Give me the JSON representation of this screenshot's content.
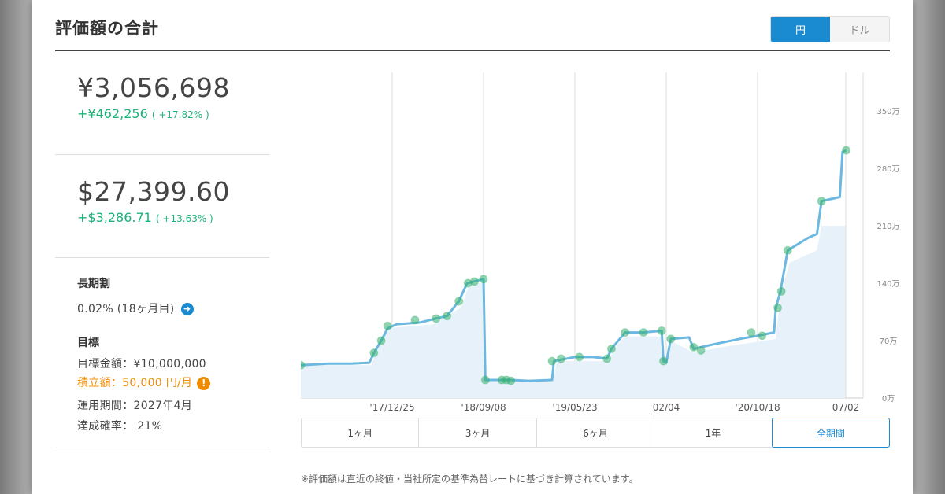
{
  "title": "評価額の合計",
  "currency_toggle": {
    "yen_label": "円",
    "dollar_label": "ドル",
    "active": "yen"
  },
  "yen_summary": {
    "amount": "¥3,056,698",
    "change": "+¥462,256",
    "change_pct": "( +17.82% )"
  },
  "usd_summary": {
    "amount": "$27,399.60",
    "change": "+$3,286.71",
    "change_pct": "( +13.63% )"
  },
  "long_term": {
    "label": "長期割",
    "value": "0.02% (18ヶ月目)"
  },
  "goal": {
    "label": "目標",
    "target_amount": "目標金額：¥10,000,000",
    "monthly_contribution": "積立額：50,000 円/月",
    "period": "運用期間：2027年4月",
    "probability": "達成確率：  21%"
  },
  "range_tabs": [
    "1ヶ月",
    "3ヶ月",
    "6ヶ月",
    "1年",
    "全期間"
  ],
  "active_range": "全期間",
  "footnote": "※評価額は直近の終値・当社所定の基準為替レートに基づき計算されています。",
  "colors": {
    "accent": "#1a8ad1",
    "positive": "#1ab37a",
    "warning": "#f08c00",
    "line": "#6cb8e0",
    "area": "#e6f1f9",
    "marker": "#33b06c"
  },
  "chart_data": {
    "type": "line",
    "x_ticks": [
      "'17/12/25",
      "'18/09/08",
      "'19/05/23",
      "02/04",
      "'20/10/18",
      "07/02"
    ],
    "y_ticks": [
      "0万",
      "70万",
      "140万",
      "210万",
      "280万",
      "350万"
    ],
    "ylim": [
      0,
      350
    ],
    "y_unit": "万円",
    "grid": "vertical",
    "series": [
      {
        "values": [
          {
            "x": 0.0,
            "y": 40
          },
          {
            "x": 0.3,
            "y": 42
          },
          {
            "x": 0.55,
            "y": 42
          },
          {
            "x": 0.75,
            "y": 43
          },
          {
            "x": 0.8,
            "y": 55
          },
          {
            "x": 0.88,
            "y": 70
          },
          {
            "x": 0.95,
            "y": 85
          },
          {
            "x": 1.05,
            "y": 90
          },
          {
            "x": 1.3,
            "y": 92
          },
          {
            "x": 1.48,
            "y": 97
          },
          {
            "x": 1.6,
            "y": 100
          },
          {
            "x": 1.73,
            "y": 118
          },
          {
            "x": 1.82,
            "y": 140
          },
          {
            "x": 2.0,
            "y": 145
          },
          {
            "x": 2.02,
            "y": 22
          },
          {
            "x": 2.3,
            "y": 22
          },
          {
            "x": 2.5,
            "y": 21
          },
          {
            "x": 2.75,
            "y": 22
          },
          {
            "x": 2.77,
            "y": 45
          },
          {
            "x": 3.0,
            "y": 50
          },
          {
            "x": 3.2,
            "y": 50
          },
          {
            "x": 3.35,
            "y": 48
          },
          {
            "x": 3.4,
            "y": 60
          },
          {
            "x": 3.55,
            "y": 80
          },
          {
            "x": 3.75,
            "y": 80
          },
          {
            "x": 3.95,
            "y": 82
          },
          {
            "x": 3.97,
            "y": 45
          },
          {
            "x": 4.0,
            "y": 43
          },
          {
            "x": 4.05,
            "y": 72
          },
          {
            "x": 4.25,
            "y": 74
          },
          {
            "x": 4.3,
            "y": 60
          },
          {
            "x": 4.5,
            "y": 65
          },
          {
            "x": 4.8,
            "y": 72
          },
          {
            "x": 5.0,
            "y": 76
          },
          {
            "x": 5.18,
            "y": 80
          },
          {
            "x": 5.2,
            "y": 110
          },
          {
            "x": 5.25,
            "y": 130
          },
          {
            "x": 5.33,
            "y": 180
          },
          {
            "x": 5.55,
            "y": 195
          },
          {
            "x": 5.65,
            "y": 200
          },
          {
            "x": 5.7,
            "y": 240
          },
          {
            "x": 5.9,
            "y": 245
          },
          {
            "x": 5.93,
            "y": 300
          },
          {
            "x": 5.97,
            "y": 302
          }
        ]
      },
      {
        "values": [
          {
            "x": 0.0,
            "y": 40
          },
          {
            "x": 0.78,
            "y": 40
          },
          {
            "x": 0.82,
            "y": 60
          },
          {
            "x": 0.95,
            "y": 85
          },
          {
            "x": 1.45,
            "y": 90
          },
          {
            "x": 1.75,
            "y": 110
          },
          {
            "x": 1.85,
            "y": 140
          },
          {
            "x": 2.0,
            "y": 140
          },
          {
            "x": 2.02,
            "y": 22
          },
          {
            "x": 2.77,
            "y": 22
          },
          {
            "x": 2.8,
            "y": 45
          },
          {
            "x": 3.38,
            "y": 45
          },
          {
            "x": 3.42,
            "y": 60
          },
          {
            "x": 3.55,
            "y": 75
          },
          {
            "x": 3.95,
            "y": 75
          },
          {
            "x": 3.97,
            "y": 45
          },
          {
            "x": 4.05,
            "y": 70
          },
          {
            "x": 4.3,
            "y": 55
          },
          {
            "x": 4.6,
            "y": 62
          },
          {
            "x": 5.2,
            "y": 72
          },
          {
            "x": 5.25,
            "y": 125
          },
          {
            "x": 5.35,
            "y": 165
          },
          {
            "x": 5.65,
            "y": 180
          },
          {
            "x": 5.7,
            "y": 210
          },
          {
            "x": 5.96,
            "y": 210
          }
        ]
      }
    ],
    "markers": [
      {
        "x": 0.0,
        "y": 40
      },
      {
        "x": 0.8,
        "y": 55
      },
      {
        "x": 0.88,
        "y": 70
      },
      {
        "x": 0.95,
        "y": 88
      },
      {
        "x": 1.25,
        "y": 95
      },
      {
        "x": 1.48,
        "y": 97
      },
      {
        "x": 1.6,
        "y": 100
      },
      {
        "x": 1.73,
        "y": 118
      },
      {
        "x": 1.83,
        "y": 140
      },
      {
        "x": 1.9,
        "y": 142
      },
      {
        "x": 2.0,
        "y": 145
      },
      {
        "x": 2.02,
        "y": 22
      },
      {
        "x": 2.2,
        "y": 22
      },
      {
        "x": 2.25,
        "y": 22
      },
      {
        "x": 2.3,
        "y": 21
      },
      {
        "x": 2.75,
        "y": 45
      },
      {
        "x": 2.85,
        "y": 48
      },
      {
        "x": 3.05,
        "y": 50
      },
      {
        "x": 3.35,
        "y": 48
      },
      {
        "x": 3.4,
        "y": 60
      },
      {
        "x": 3.55,
        "y": 80
      },
      {
        "x": 3.75,
        "y": 80
      },
      {
        "x": 3.95,
        "y": 82
      },
      {
        "x": 3.97,
        "y": 45
      },
      {
        "x": 4.05,
        "y": 72
      },
      {
        "x": 4.3,
        "y": 62
      },
      {
        "x": 4.38,
        "y": 58
      },
      {
        "x": 4.93,
        "y": 80
      },
      {
        "x": 5.05,
        "y": 76
      },
      {
        "x": 5.22,
        "y": 110
      },
      {
        "x": 5.26,
        "y": 130
      },
      {
        "x": 5.33,
        "y": 180
      },
      {
        "x": 5.7,
        "y": 240
      },
      {
        "x": 5.97,
        "y": 302
      }
    ]
  }
}
